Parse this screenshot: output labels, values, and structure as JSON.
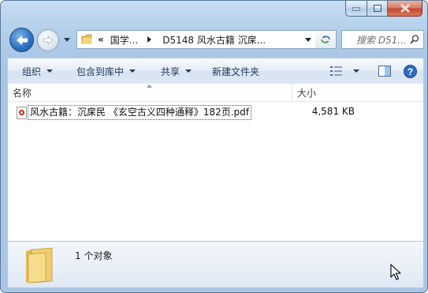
{
  "window": {
    "minimize_icon": "minimize-icon",
    "maximize_icon": "maximize-icon",
    "close_icon": "close-icon"
  },
  "nav": {
    "breadcrumb_overflow": "«",
    "crumbs": [
      "国学...",
      "D5148 风水古籍 沉㦿..."
    ],
    "search_placeholder": "搜索 D51..."
  },
  "toolbar": {
    "organize": "组织",
    "include_library": "包含到库中",
    "share": "共享",
    "new_folder": "新建文件夹"
  },
  "columns": {
    "name": "名称",
    "size": "大小"
  },
  "files": [
    {
      "name": "风水古籍：沉㦿民 《玄空古义四种通释》182页.pdf",
      "size": "4,581 KB",
      "icon": "pdf-file-icon"
    }
  ],
  "details": {
    "count_text": "1 个对象"
  },
  "colors": {
    "frame": "#b8d2ec",
    "selection_border": "#555555",
    "pdf_red": "#d2261a",
    "help_blue": "#2a6cc4"
  }
}
